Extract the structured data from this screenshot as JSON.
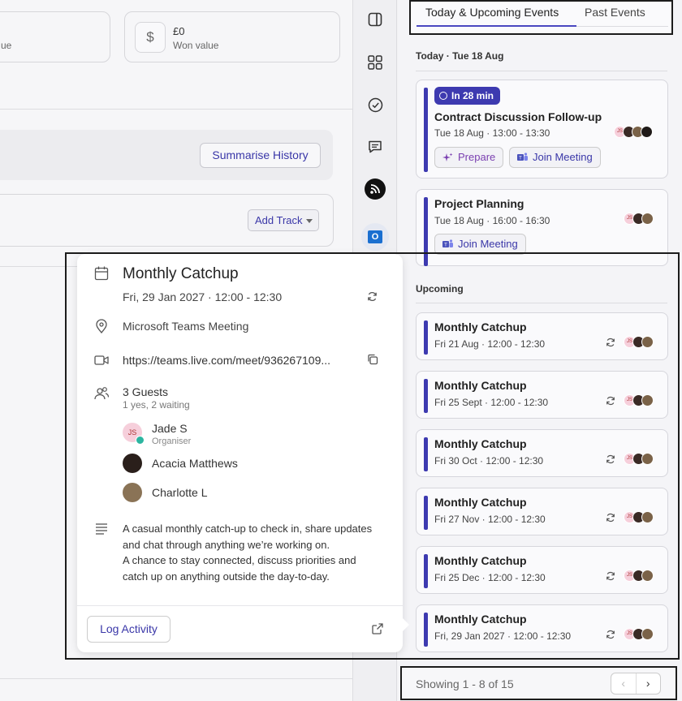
{
  "background": {
    "stat_left_label": "ue",
    "stat_currency_icon": "$",
    "stat_value": "£0",
    "stat_label": "Won value",
    "summarise_label": "Summarise History",
    "add_track_label": "Add Track"
  },
  "rail": {
    "icons": [
      "panel-icon",
      "apps-grid-icon",
      "check-circle-icon",
      "chat-icon",
      "rss-icon",
      "outlook-icon"
    ]
  },
  "events": {
    "tabs": [
      "Today & Upcoming Events",
      "Past Events"
    ],
    "today_label": "Today · Tue 18 Aug",
    "upcoming_label": "Upcoming",
    "today_events": [
      {
        "badge": "In 28 min",
        "title": "Contract Discussion Follow-up",
        "time": "Tue 18 Aug · 13:00 - 13:30",
        "prepare": "Prepare",
        "join": "Join Meeting"
      },
      {
        "title": "Project Planning",
        "time": "Tue 18 Aug · 16:00 - 16:30",
        "join": "Join Meeting"
      }
    ],
    "upcoming_events": [
      {
        "title": "Monthly Catchup",
        "time": "Fri 21 Aug · 12:00 - 12:30"
      },
      {
        "title": "Monthly Catchup",
        "time": "Fri 25 Sept · 12:00 - 12:30"
      },
      {
        "title": "Monthly Catchup",
        "time": "Fri 30 Oct · 12:00 - 12:30"
      },
      {
        "title": "Monthly Catchup",
        "time": "Fri 27 Nov · 12:00 - 12:30"
      },
      {
        "title": "Monthly Catchup",
        "time": "Fri 25 Dec · 12:00 - 12:30"
      },
      {
        "title": "Monthly Catchup",
        "time": "Fri, 29 Jan 2027 · 12:00 - 12:30"
      }
    ],
    "avatar_initials": "JS",
    "showing": "Showing 1 - 8 of 15",
    "prev": "‹",
    "next": "›"
  },
  "popup": {
    "title": "Monthly Catchup",
    "date": "Fri, 29 Jan 2027 · 12:00 - 12:30",
    "location": "Microsoft Teams Meeting",
    "link": "https://teams.live.com/meet/936267109...",
    "guests_count": "3 Guests",
    "guests_status": "1 yes, 2 waiting",
    "guests": [
      {
        "initials": "JS",
        "name": "Jade S",
        "role": "Organiser"
      },
      {
        "name": "Acacia Matthews"
      },
      {
        "name": "Charlotte L"
      }
    ],
    "description": [
      "A casual monthly catch-up to check in, share updates",
      "and chat through anything we’re working on.",
      "A chance to stay connected, discuss priorities and",
      "catch up on anything outside the day-to-day."
    ],
    "log_activity": "Log Activity"
  },
  "colors": {
    "accent": "#3d3ab0",
    "link": "#3a37a8",
    "prepare": "#7a3fb0"
  }
}
